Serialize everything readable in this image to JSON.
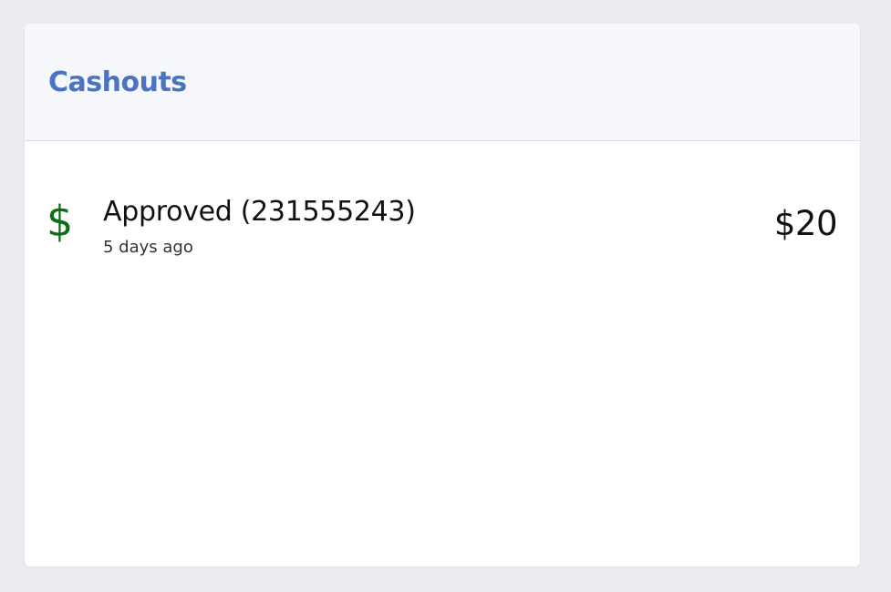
{
  "cashouts": {
    "title": "Cashouts",
    "items": [
      {
        "icon": "dollar-icon",
        "icon_color": "#0e6e18",
        "icon_glyph": "$",
        "status": "Approved (231555243)",
        "time": "5 days ago",
        "amount": "$20"
      }
    ]
  },
  "colors": {
    "title": "#4a74c1",
    "header_background": "#f6f7fb",
    "page_background": "#ebebf0"
  }
}
